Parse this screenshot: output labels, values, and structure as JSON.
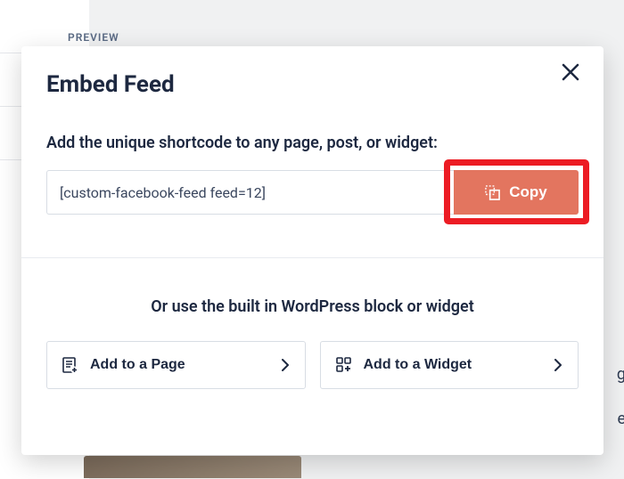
{
  "background": {
    "preview_label": "PREVIEW",
    "partial_right_1": "g",
    "partial_right_2": "e"
  },
  "modal": {
    "title": "Embed Feed",
    "instruction": "Add the unique shortcode to any page, post, or widget:",
    "shortcode_value": "[custom-facebook-feed feed=12]",
    "copy_label": "Copy",
    "or_text": "Or use the built in WordPress block or widget",
    "add_page_label": "Add to a Page",
    "add_widget_label": "Add to a Widget"
  }
}
